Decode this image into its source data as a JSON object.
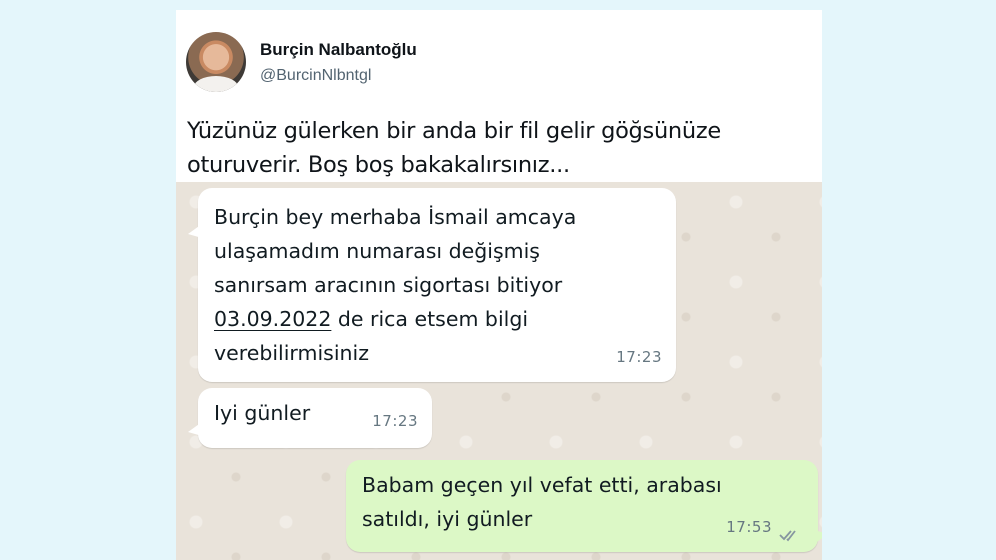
{
  "tweet": {
    "display_name": "Burçin Nalbantoğlu",
    "handle": "@BurcinNlbntgl",
    "text_line1": "Yüzünüz gülerken bir anda bir fil gelir göğsünüze",
    "text_line2": "oturuverir. Boş boş bakakalırsınız..."
  },
  "messages": [
    {
      "direction": "incoming",
      "line1": "Burçin bey merhaba İsmail amcaya",
      "line2": "ulaşamadım numarası değişmiş",
      "line3": "sanırsam aracının sigortası bitiyor",
      "date": "03.09.2022",
      "line4_rest": " de rica etsem bilgi",
      "line5": "verebilirmisiniz",
      "time": "17:23"
    },
    {
      "direction": "incoming",
      "text": "Iyi günler",
      "time": "17:23"
    },
    {
      "direction": "outgoing",
      "line1": "Babam geçen yıl vefat etti, arabası",
      "line2": "satıldı, iyi günler",
      "time": "17:53",
      "status": "read"
    }
  ],
  "colors": {
    "page_background": "#e4f6fb",
    "incoming_bubble": "#ffffff",
    "outgoing_bubble": "#dcf8c6",
    "chat_background": "#e9e3da"
  },
  "icons": {
    "read_receipt": "double-check-icon"
  }
}
